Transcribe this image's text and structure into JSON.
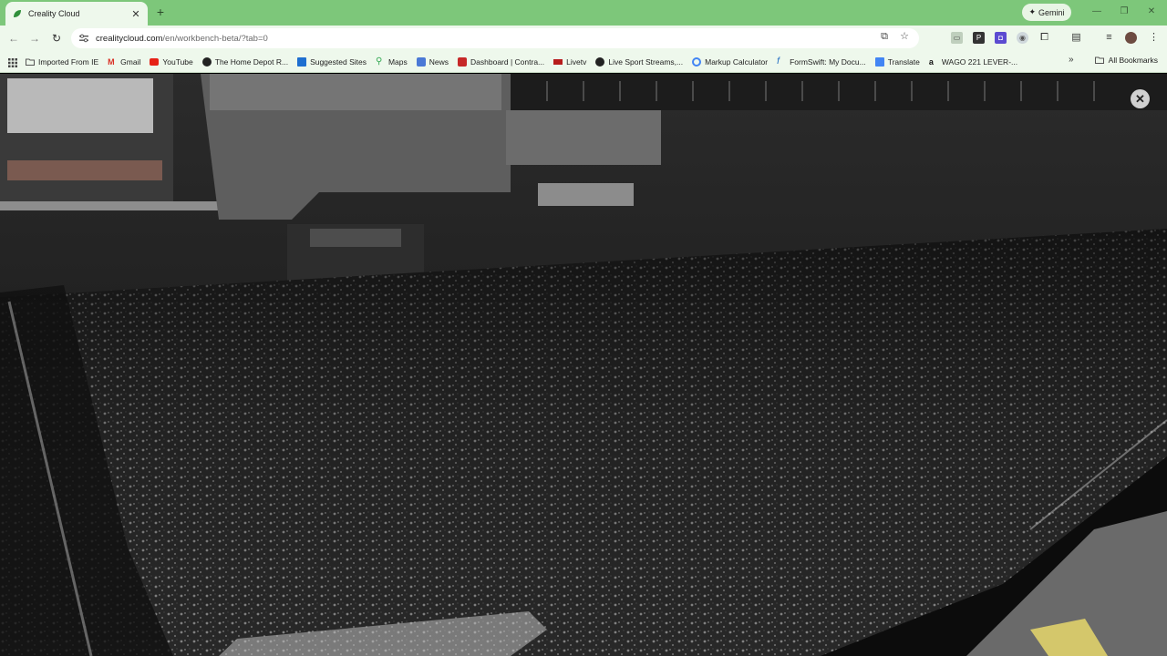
{
  "browser": {
    "tab": {
      "title": "Creality Cloud",
      "favicon": "creality-leaf-icon",
      "close": "✕"
    },
    "new_tab": "+",
    "gemini_label": "Gemini",
    "window_controls": {
      "minimize": "—",
      "restore": "❐",
      "close": "✕"
    }
  },
  "toolbar": {
    "url_host": "crealitycloud.com",
    "url_path": "/en/workbench-beta/?tab=0"
  },
  "bookmarks": [
    {
      "label": "Imported From IE",
      "icon": "folder-icon"
    },
    {
      "label": "Gmail",
      "icon": "gmail-icon"
    },
    {
      "label": "YouTube",
      "icon": "youtube-icon"
    },
    {
      "label": "The Home Depot R...",
      "icon": "homedepot-icon"
    },
    {
      "label": "Suggested Sites",
      "icon": "suggested-sites-icon"
    },
    {
      "label": "Maps",
      "icon": "maps-icon"
    },
    {
      "label": "News",
      "icon": "news-icon"
    },
    {
      "label": "Dashboard | Contra...",
      "icon": "dashboard-icon"
    },
    {
      "label": "Livetv",
      "icon": "livetv-icon"
    },
    {
      "label": "Live Sport Streams,...",
      "icon": "sport-streams-icon"
    },
    {
      "label": "Markup Calculator",
      "icon": "markup-calculator-icon"
    },
    {
      "label": "FormSwift: My Docu...",
      "icon": "formswift-icon"
    },
    {
      "label": "Translate",
      "icon": "translate-icon"
    },
    {
      "label": "WAGO 221 LEVER-...",
      "icon": "amazon-icon"
    }
  ],
  "all_bookmarks_label": "All Bookmarks",
  "overlay": {
    "close": "✕"
  },
  "colors": {
    "tabstrip": "#7dc77a",
    "toolbar": "#eef8ec",
    "accent_green": "#2f8f3a"
  }
}
